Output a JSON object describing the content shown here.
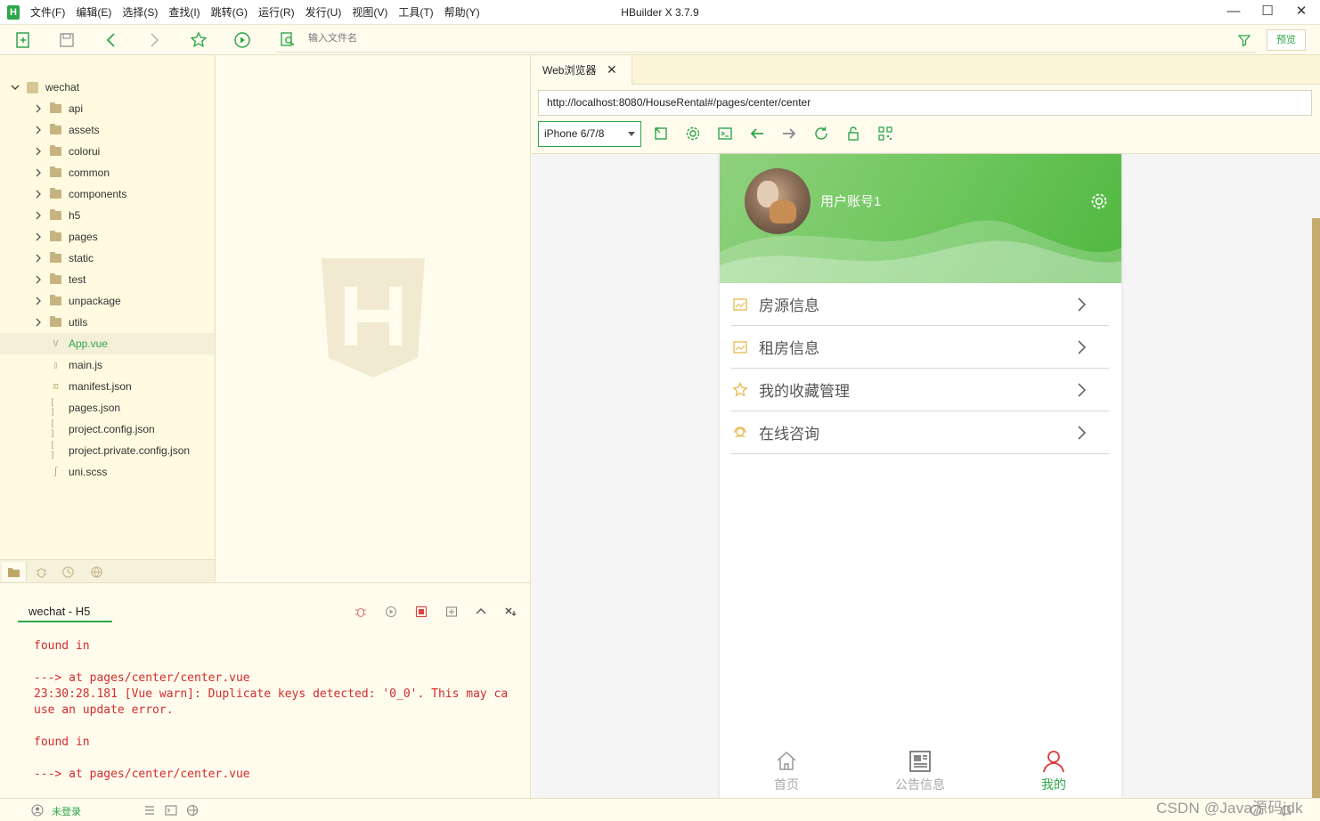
{
  "app": {
    "window_title": "HBuilder X 3.7.9",
    "menus": [
      "文件(F)",
      "编辑(E)",
      "选择(S)",
      "查找(I)",
      "跳转(G)",
      "运行(R)",
      "发行(U)",
      "视图(V)",
      "工具(T)",
      "帮助(Y)"
    ]
  },
  "toolbar": {
    "file_search_placeholder": "输入文件名",
    "preview_label": "预览"
  },
  "explorer": {
    "project": "wechat",
    "folders": [
      "api",
      "assets",
      "colorui",
      "common",
      "components",
      "h5",
      "pages",
      "static",
      "test",
      "unpackage",
      "utils"
    ],
    "files": [
      {
        "name": "App.vue",
        "icon": "V",
        "selected": true
      },
      {
        "name": "main.js",
        "icon": "▯",
        "selected": false
      },
      {
        "name": "manifest.json",
        "icon": "⊡",
        "selected": false
      },
      {
        "name": "pages.json",
        "icon": "[ ]",
        "selected": false
      },
      {
        "name": "project.config.json",
        "icon": "[ ]",
        "selected": false
      },
      {
        "name": "project.private.config.json",
        "icon": "[ ]",
        "selected": false
      },
      {
        "name": "uni.scss",
        "icon": "∫",
        "selected": false
      }
    ]
  },
  "console": {
    "tab_label": "wechat - H5",
    "lines": [
      "found in",
      "",
      "---> at pages/center/center.vue",
      "23:30:28.181 [Vue warn]: Duplicate keys detected: '0_0'. This may ca",
      "use an update error.",
      "",
      "found in",
      "",
      "---> at pages/center/center.vue"
    ]
  },
  "status": {
    "login_label": "未登录",
    "watermark": "CSDN @Java源码jdk"
  },
  "browser": {
    "tab_label": "Web浏览器",
    "url": "http://localhost:8080/HouseRental#/pages/center/center",
    "device": "iPhone 6/7/8"
  },
  "phone": {
    "username": "用户账号1",
    "menu": [
      {
        "label": "房源信息",
        "icon": "chart-icon"
      },
      {
        "label": "租房信息",
        "icon": "chart-icon"
      },
      {
        "label": "我的收藏管理",
        "icon": "star-icon"
      },
      {
        "label": "在线咨询",
        "icon": "headset-icon"
      }
    ],
    "tabbar": [
      {
        "label": "首页",
        "icon": "home-icon",
        "active": false
      },
      {
        "label": "公告信息",
        "icon": "newspaper-icon",
        "active": false
      },
      {
        "label": "我的",
        "icon": "user-icon",
        "active": true
      }
    ]
  },
  "colors": {
    "accent": "#2ea64a",
    "console_error": "#d42b2b",
    "editor_bg": "#fffcee",
    "menu_icon": "#e8b84a"
  }
}
